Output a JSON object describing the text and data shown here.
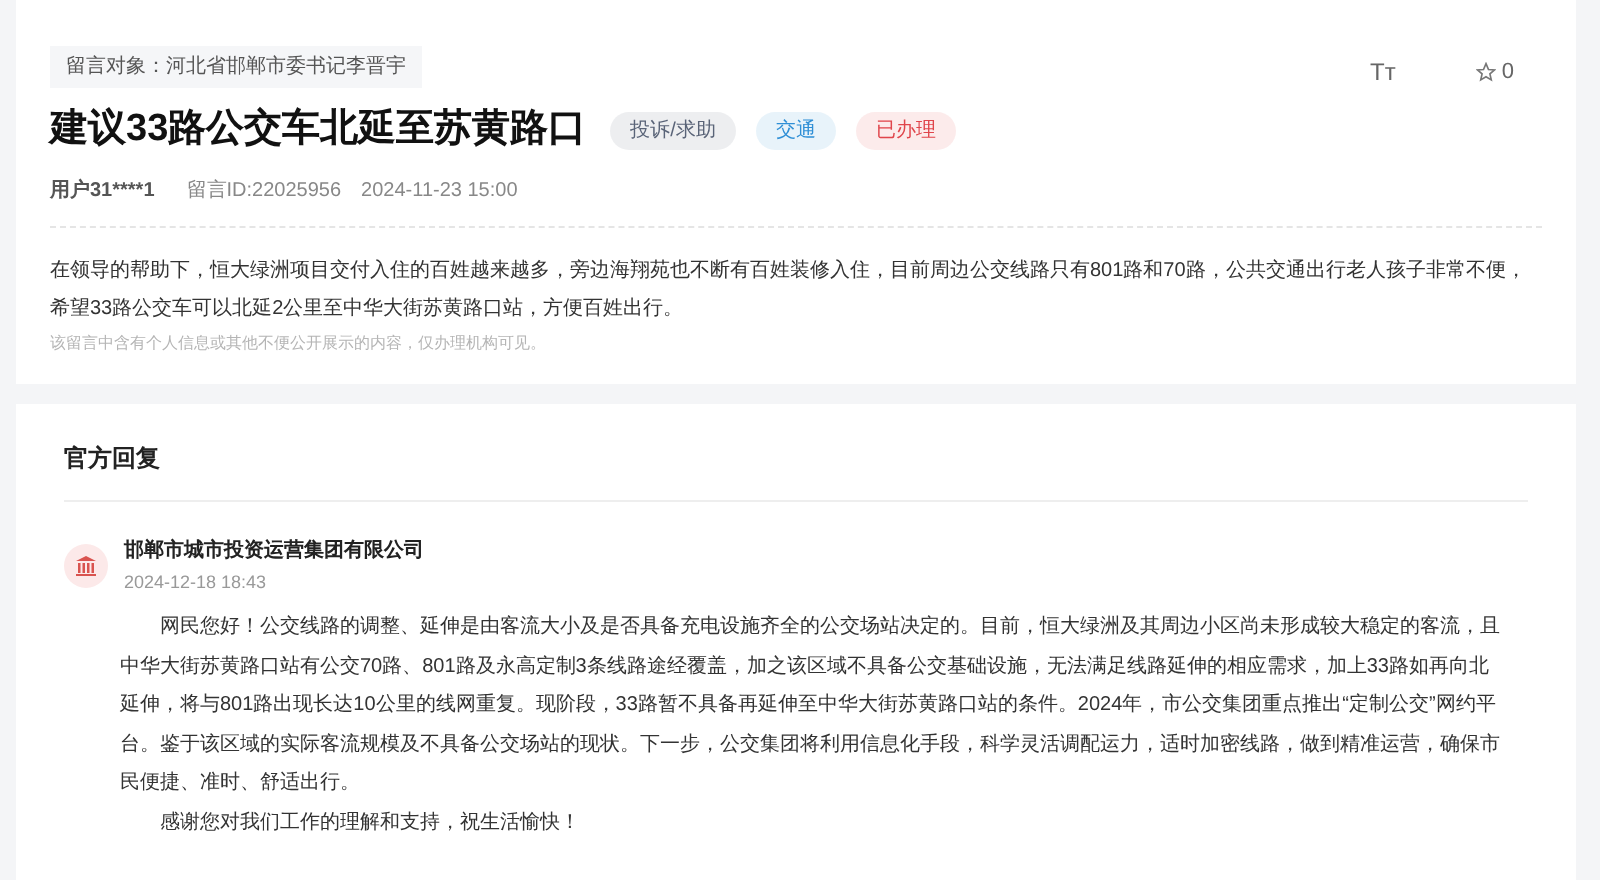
{
  "message": {
    "target": "留言对象：河北省邯郸市委书记李晋宇",
    "title": "建议33路公交车北延至苏黄路口",
    "tags": [
      {
        "label": "投诉/求助",
        "color": "#5a6478"
      },
      {
        "label": "交通",
        "color": "#2f8fd6"
      },
      {
        "label": "已办理",
        "color": "#e0454b"
      }
    ],
    "font_toggle": "Tт",
    "star_count": "0",
    "user": "用户31****1",
    "message_id": "留言ID:22025956",
    "time": "2024-11-23 15:00",
    "body": "在领导的帮助下，恒大绿洲项目交付入住的百姓越来越多，旁边海翔苑也不断有百姓装修入住，目前周边公交线路只有801路和70路，公共交通出行老人孩子非常不便，希望33路公交车可以北延2公里至中华大街苏黄路口站，方便百姓出行。",
    "privacy_note": "该留言中含有个人信息或其他不便公开展示的内容，仅办理机构可见。"
  },
  "reply": {
    "heading": "官方回复",
    "org": "邯郸市城市投资运营集团有限公司",
    "time": "2024-12-18 18:43",
    "paragraphs": [
      "网民您好！公交线路的调整、延伸是由客流大小及是否具备充电设施齐全的公交场站决定的。目前，恒大绿洲及其周边小区尚未形成较大稳定的客流，且中华大街苏黄路口站有公交70路、801路及永高定制3条线路途经覆盖，加之该区域不具备公交基础设施，无法满足线路延伸的相应需求，加上33路如再向北延伸，将与801路出现长达10公里的线网重复。现阶段，33路暂不具备再延伸至中华大街苏黄路口站的条件。2024年，市公交集团重点推出“定制公交”网约平台。鉴于该区域的实际客流规模及不具备公交场站的现状。下一步，公交集团将利用信息化手段，科学灵活调配运力，适时加密线路，做到精准运营，确保市民便捷、准时、舒适出行。",
      "感谢您对我们工作的理解和支持，祝生活愉快！"
    ]
  }
}
